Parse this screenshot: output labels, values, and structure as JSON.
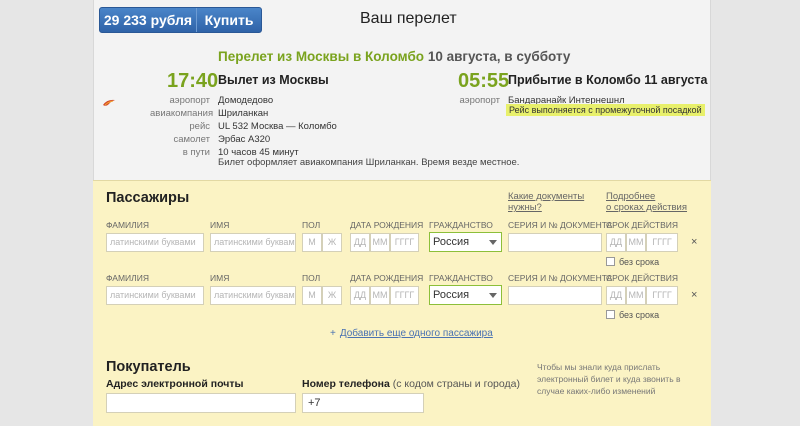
{
  "header": {
    "price": "29 233 рубля",
    "buy_label": "Купить",
    "title": "Ваш перелет"
  },
  "flight": {
    "route_green": "Перелет из Москвы в Коломбо",
    "route_date": "10 августа, в субботу",
    "depart": {
      "time": "17:40",
      "heading": "Вылет из Москвы",
      "rows": [
        {
          "k": "аэропорт",
          "v": "Домодедово"
        },
        {
          "k": "авиакомпания",
          "v": "Шриланкан"
        },
        {
          "k": "рейс",
          "v": "UL 532 Москва — Коломбо"
        },
        {
          "k": "самолет",
          "v": "Эрбас А320"
        },
        {
          "k": "в пути",
          "v": "10 часов 45 минут"
        }
      ]
    },
    "arrive": {
      "time": "05:55",
      "heading": "Прибытие в Коломбо 11 августа",
      "airport_label": "аэропорт",
      "airport": "Бандаранайк Интернешнл",
      "stopover": "Рейс выполняется с промежуточной посадкой"
    },
    "note": "Билет оформляет авиакомпания Шриланкан. Время везде местное.",
    "airline_logo_icon": "srilankan-peacock-icon"
  },
  "passengers": {
    "heading": "Пассажиры",
    "docs_link_line1": "Какие документы",
    "docs_link_line2": "нужны?",
    "validity_link_line1": "Подробнее",
    "validity_link_line2": "о сроках действия",
    "labels": {
      "lastname": "ФАМИЛИЯ",
      "firstname": "ИМЯ",
      "gender": "ПОЛ",
      "birthdate": "ДАТА РОЖДЕНИЯ",
      "citizenship": "ГРАЖДАНСТВО",
      "document": "СЕРИЯ И № ДОКУМЕНТА",
      "expiry": "СРОК ДЕЙСТВИЯ"
    },
    "placeholders": {
      "lastname": "латинскими буквами",
      "firstname": "латинскими буквами",
      "gender_m": "М",
      "gender_f": "Ж",
      "dd": "ДД",
      "mm": "ММ",
      "yyyy": "ГГГГ"
    },
    "rows": [
      {
        "citizenship": "Россия",
        "no_expiry": "без срока",
        "remove": "×"
      },
      {
        "citizenship": "Россия",
        "no_expiry": "без срока",
        "remove": "×"
      }
    ],
    "add_plus": "+",
    "add_label": "Добавить еще одного пассажира"
  },
  "buyer": {
    "heading": "Покупатель",
    "email_label": "Адрес электронной почты",
    "phone_label": "Номер телефона",
    "phone_hint": "(с кодом страны и города)",
    "phone_value": "+7",
    "note": "Чтобы мы знали куда прислать электронный билет и куда звонить в случае каких-либо изменений"
  },
  "colors": {
    "accent_green": "#7aa31e",
    "button_blue": "#2f63a8",
    "panel_yellow": "#fbf3c4",
    "stopover_highlight": "#e8f06b"
  }
}
